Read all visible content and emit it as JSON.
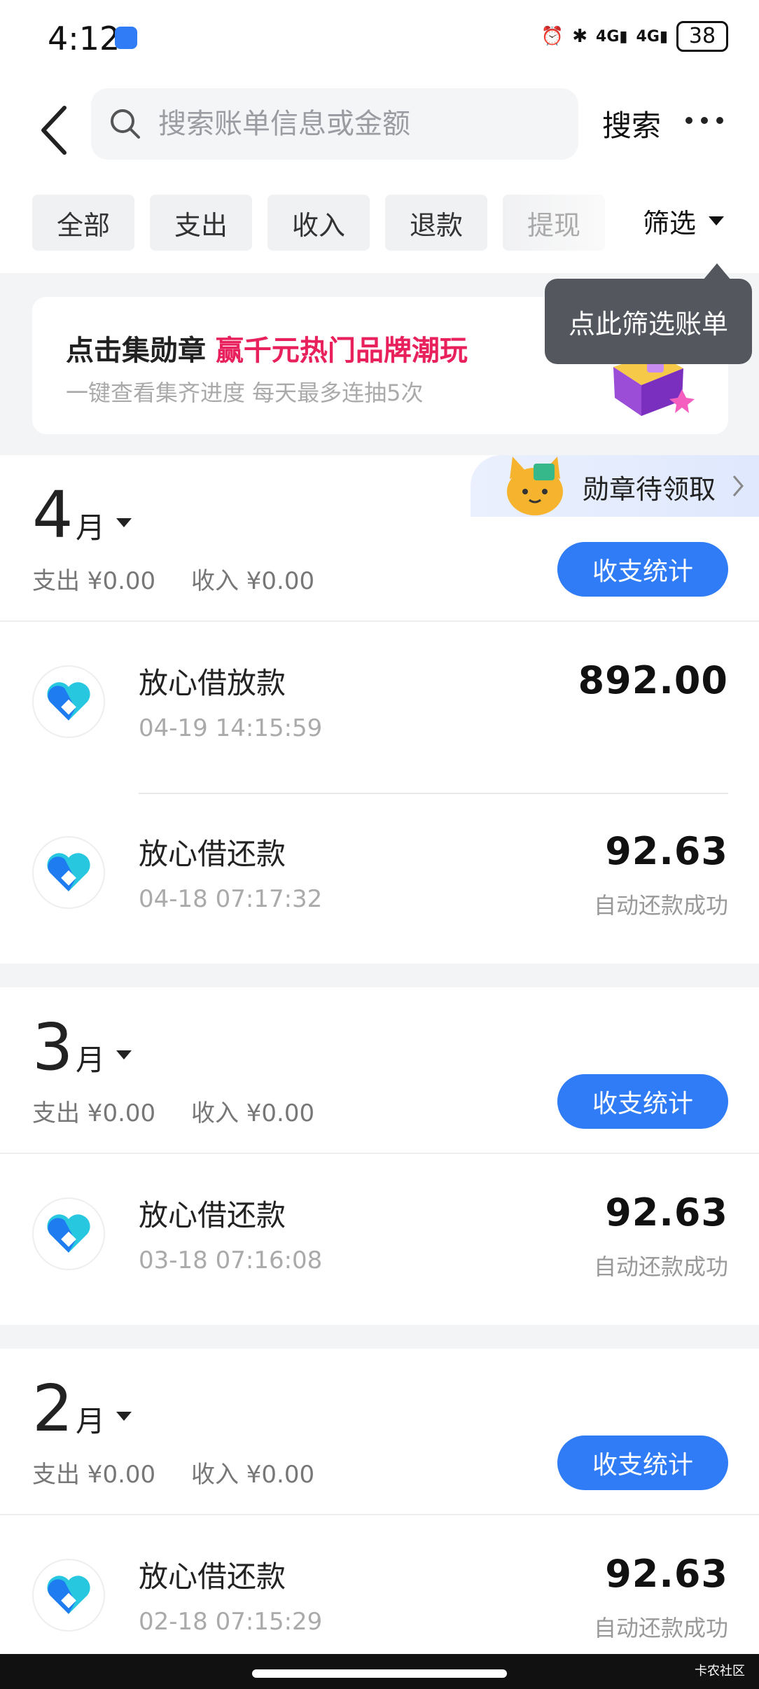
{
  "status_bar": {
    "time": "4:12",
    "network_1": "4G",
    "network_2": "4G",
    "battery": "38"
  },
  "header": {
    "search_placeholder": "搜索账单信息或金额",
    "search_button": "搜索",
    "tabs": [
      "全部",
      "支出",
      "收入",
      "退款",
      "提现"
    ],
    "filter_label": "筛选",
    "tooltip": "点此筛选账单"
  },
  "banner": {
    "title_plain": "点击集勋章",
    "title_highlight": "赢千元热门品牌潮玩",
    "subtitle": "一键查看集齐进度 每天最多连抽5次"
  },
  "medal_tag": {
    "label": "勋章待领取"
  },
  "months": [
    {
      "number": "4",
      "unit": "月",
      "expense": "支出 ¥0.00",
      "income": "收入 ¥0.00",
      "stats_button": "收支统计",
      "transactions": [
        {
          "title": "放心借放款",
          "time": "04-19 14:15:59",
          "amount": "892.00",
          "status": ""
        },
        {
          "title": "放心借还款",
          "time": "04-18 07:17:32",
          "amount": "92.63",
          "status": "自动还款成功"
        }
      ]
    },
    {
      "number": "3",
      "unit": "月",
      "expense": "支出 ¥0.00",
      "income": "收入 ¥0.00",
      "stats_button": "收支统计",
      "transactions": [
        {
          "title": "放心借还款",
          "time": "03-18 07:16:08",
          "amount": "92.63",
          "status": "自动还款成功"
        }
      ]
    },
    {
      "number": "2",
      "unit": "月",
      "expense": "支出 ¥0.00",
      "income": "收入 ¥0.00",
      "stats_button": "收支统计",
      "transactions": [
        {
          "title": "放心借还款",
          "time": "02-18 07:15:29",
          "amount": "92.63",
          "status": "自动还款成功"
        }
      ]
    }
  ],
  "watermark": "卡农社区",
  "colors": {
    "accent": "#2f7cf6",
    "highlight": "#e8205b",
    "tooltip_bg": "#54575e"
  }
}
